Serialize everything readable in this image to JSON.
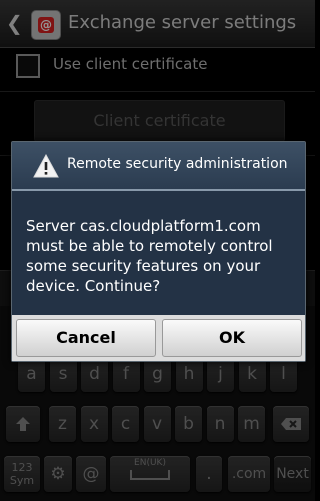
{
  "app_bar": {
    "back_icon": "chevron-left-icon",
    "app_icon": "email-at-icon",
    "app_icon_glyph": "@",
    "title": "Exchange server settings"
  },
  "settings": {
    "use_client_certificate_label": "Use client certificate",
    "use_client_certificate_checked": false,
    "client_certificate_button": "Client certificate"
  },
  "dialog": {
    "icon": "warning-triangle-icon",
    "title": "Remote security administration",
    "message": "Server cas.cloudplatform1.com must be able to remotely control some security features on your device. Continue?",
    "cancel_label": "Cancel",
    "ok_label": "OK"
  },
  "keyboard": {
    "row_asdf": [
      "a",
      "s",
      "d",
      "f",
      "g",
      "h",
      "j",
      "k",
      "l"
    ],
    "row_zxcv": [
      "z",
      "x",
      "c",
      "v",
      "b",
      "n",
      "m"
    ],
    "shift_icon": "shift-arrow-icon",
    "backspace_icon": "backspace-icon",
    "sym_key_line1": "123",
    "sym_key_line2": "Sym",
    "settings_icon": "gear-icon",
    "at_key": "@",
    "space_label": "EN(UK)",
    "dot_key": ".",
    "dotcom_key": ".com",
    "next_key": "Next"
  },
  "colors": {
    "dialog_header": "#2b3c50",
    "dialog_body": "#233245",
    "dialog_footer": "#dcdcdc"
  }
}
